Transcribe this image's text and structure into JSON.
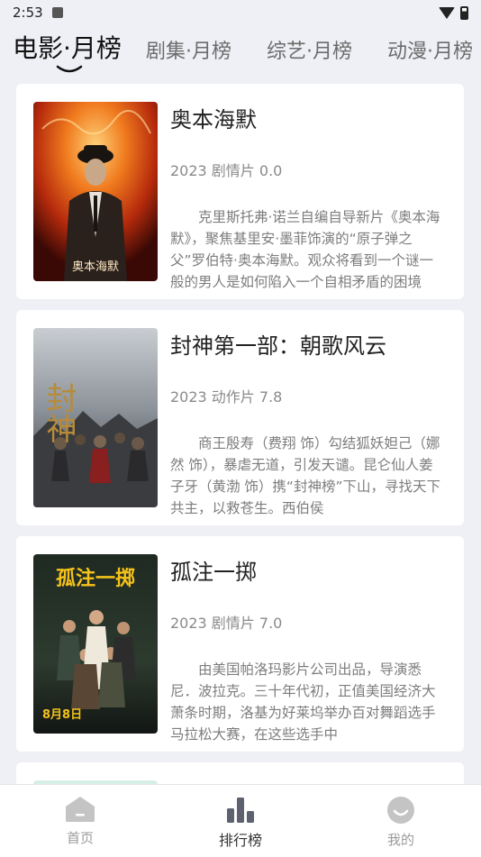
{
  "status": {
    "time": "2:53"
  },
  "tabs": [
    {
      "label": "电影·月榜",
      "active": true
    },
    {
      "label": "剧集·月榜",
      "active": false
    },
    {
      "label": "综艺·月榜",
      "active": false
    },
    {
      "label": "动漫·月榜",
      "active": false
    }
  ],
  "movies": [
    {
      "title": "奥本海默",
      "meta": "2023 剧情片 0.0",
      "desc": "克里斯托弗·诺兰自编自导新片《奥本海默》，聚焦基里安·墨菲饰演的“原子弹之父”罗伯特·奥本海默。观众将看到一个谜一般的男人是如何陷入一个自相矛盾的困境",
      "poster_text": "奥本海默"
    },
    {
      "title": "封神第一部：朝歌风云",
      "meta": "2023 动作片 7.8",
      "desc": "商王殷寿（费翔 饰）勾结狐妖妲己（娜然 饰），暴虐无道，引发天谴。昆仑仙人姜子牙（黄渤 饰）携“封神榜”下山，寻找天下共主，以救苍生。西伯侯",
      "poster_text": "封神"
    },
    {
      "title": "孤注一掷",
      "meta": "2023 剧情片 7.0",
      "desc": "由美国帕洛玛影片公司出品，导演悉尼．波拉克。三十年代初，正值美国经济大萧条时期，洛基为好莱坞举办百对舞蹈选手马拉松大赛，在这些选手中",
      "poster_text": "孤注一掷",
      "poster_date": "8月8日"
    }
  ],
  "bottom_nav": [
    {
      "label": "首页",
      "icon": "home-icon",
      "active": false
    },
    {
      "label": "排行榜",
      "icon": "ranking-icon",
      "active": true
    },
    {
      "label": "我的",
      "icon": "profile-icon",
      "active": false
    }
  ]
}
